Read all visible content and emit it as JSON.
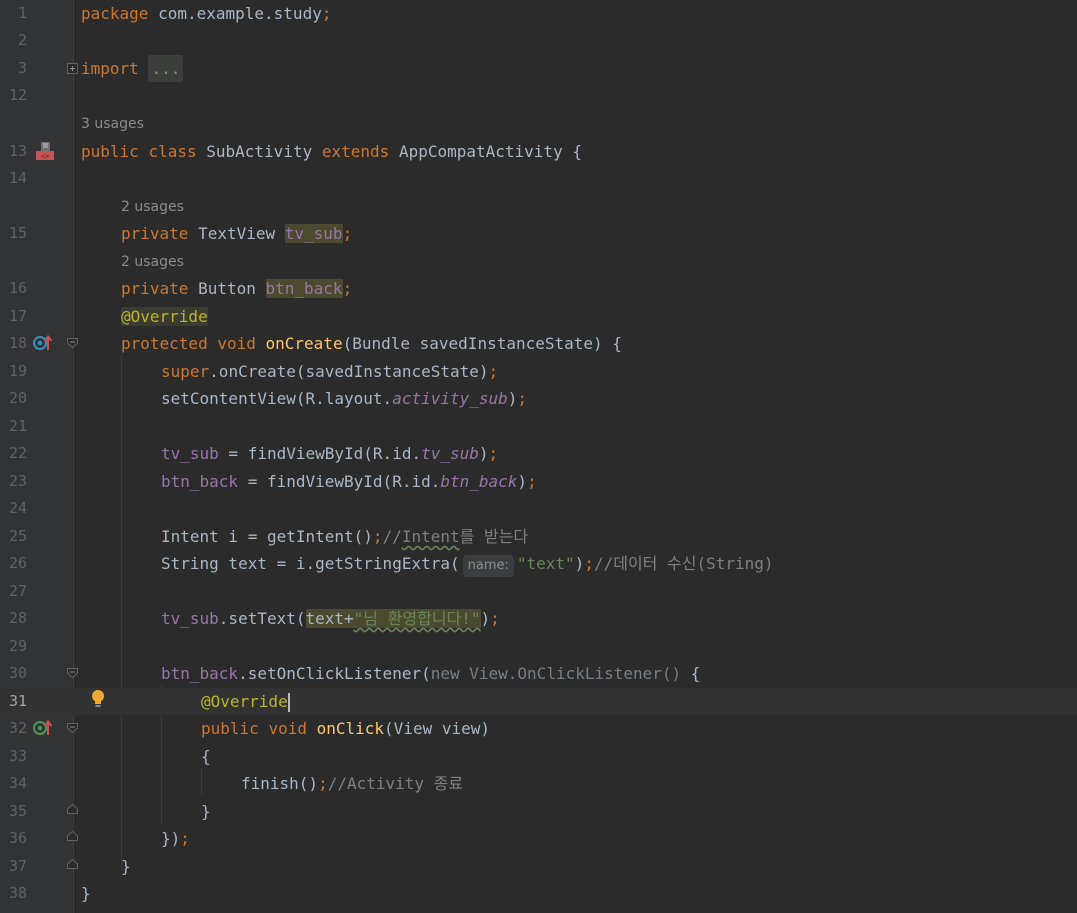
{
  "gutter": {
    "line_numbers": [
      "1",
      "2",
      "3",
      "12",
      "13",
      "14",
      "15",
      "16",
      "17",
      "18",
      "19",
      "20",
      "21",
      "22",
      "23",
      "24",
      "25",
      "26",
      "27",
      "28",
      "29",
      "30",
      "31",
      "32",
      "33",
      "34",
      "35",
      "36",
      "37",
      "38"
    ]
  },
  "hints": {
    "usages_3": "3 usages",
    "usages_2a": "2 usages",
    "usages_2b": "2 usages",
    "param_name": "name:"
  },
  "code": {
    "l1_kw": "package",
    "l1_pkg": " com.example.study",
    "l1_semi": ";",
    "l3_kw": "import",
    "l3_fold": "...",
    "l13_kw1": "public",
    "l13_kw2": "class",
    "l13_name": "SubActivity",
    "l13_kw3": "extends",
    "l13_parent": "AppCompatActivity",
    "l13_brace": " {",
    "l15_kw": "private",
    "l15_type": " TextView ",
    "l15_field": "tv_sub",
    "l15_semi": ";",
    "l16_kw": "private",
    "l16_type": " Button ",
    "l16_field": "btn_back",
    "l16_semi": ";",
    "l17_ann": "@Override",
    "l18_kw1": "protected",
    "l18_kw2": "void",
    "l18_fn": "onCreate",
    "l18_rest": "(Bundle savedInstanceState) {",
    "l19_super": "super",
    "l19_rest": ".onCreate(savedInstanceState)",
    "l19_semi": ";",
    "l20_a": "setContentView(R.layout.",
    "l20_field": "activity_sub",
    "l20_b": ")",
    "l20_semi": ";",
    "l22_field": "tv_sub",
    "l22_a": " = findViewById(R.id.",
    "l22_id": "tv_sub",
    "l22_b": ")",
    "l22_semi": ";",
    "l23_field": "btn_back",
    "l23_a": " = findViewById(R.id.",
    "l23_id": "btn_back",
    "l23_b": ")",
    "l23_semi": ";",
    "l25_a": "Intent i = getIntent()",
    "l25_semi": ";",
    "l25_cmt1": "//",
    "l25_cmt2": "Intent",
    "l25_cmt3": "를 받는다",
    "l26_a": "String text = i.getStringExtra(",
    "l26_str": "\"text\"",
    "l26_b": ")",
    "l26_semi": ";",
    "l26_cmt": "//데이터 수신(String)",
    "l28_field": "tv_sub",
    "l28_a": ".setText(",
    "l28_b": "text+",
    "l28_str": "\"님 환영합니다!\"",
    "l28_c": ")",
    "l28_semi": ";",
    "l30_field": "btn_back",
    "l30_a": ".setOnClickListener(",
    "l30_dim": "new View.OnClickListener()",
    "l30_b": " {",
    "l31_ann": "@Override",
    "l32_kw1": "public",
    "l32_kw2": "void",
    "l32_fn": "onClick",
    "l32_rest": "(View view)",
    "l33_brace": "{",
    "l34_a": "finish()",
    "l34_semi": ";",
    "l34_cmt": "//Activity 종료",
    "l35_brace": "}",
    "l36_a": "})",
    "l36_semi": ";",
    "l37_brace": "}",
    "l38_brace": "}"
  },
  "colors": {
    "background": "#2b2b2b",
    "gutter": "#313335",
    "keyword": "#cc7832",
    "field": "#9876aa",
    "method": "#ffc66d",
    "annotation": "#bbb529",
    "string": "#6a8759",
    "comment": "#808080"
  },
  "icons": {
    "line13": "android-activity-icon",
    "line18": "override-method-icon",
    "line31": "intention-bulb-icon",
    "line32": "override-method-icon"
  }
}
